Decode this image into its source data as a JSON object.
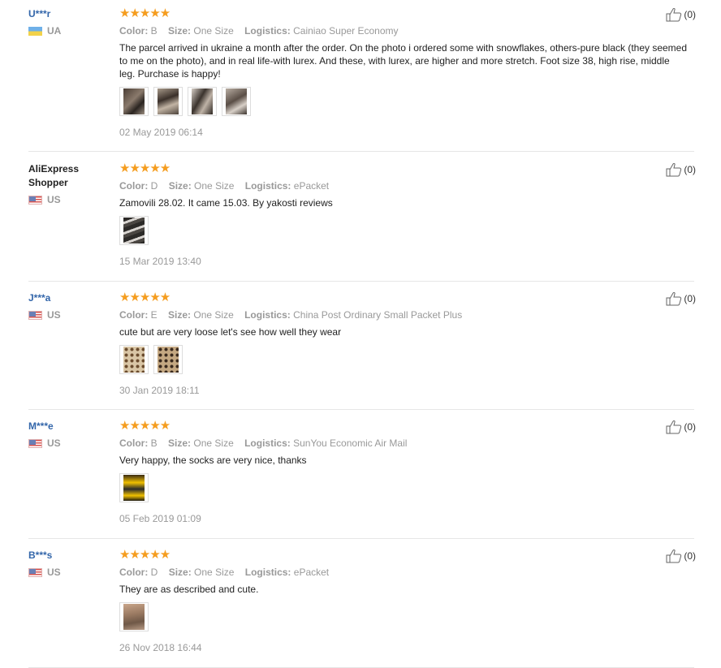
{
  "reviews": [
    {
      "user": "U***r",
      "country": "UA",
      "stars": "★★★★★",
      "color_label": "Color:",
      "color": "B",
      "size_label": "Size:",
      "size": "One Size",
      "logistics_label": "Logistics:",
      "logistics": "Cainiao Super Economy",
      "text": "The parcel arrived in ukraine a month after the order. On the photo i ordered some with snowflakes, others-pure black (they seemed to me on the photo), and in real life-with lurex. And these, with lurex, are higher and more stretch. Foot size 38, high rise, middle leg. Purchase is happy!",
      "date": "02 May 2019 06:14",
      "helpful": "(0)",
      "helpful_icon": "thumbs-up-icon",
      "photo_count": 4
    },
    {
      "user": "AliExpress Shopper",
      "country": "US",
      "stars": "★★★★★",
      "color_label": "Color:",
      "color": "D",
      "size_label": "Size:",
      "size": "One Size",
      "logistics_label": "Logistics:",
      "logistics": "ePacket",
      "text": "Zamovili 28.02. It came 15.03. By yakosti reviews",
      "date": "15 Mar 2019 13:40",
      "helpful": "(0)",
      "helpful_icon": "thumbs-up-icon",
      "photo_count": 1
    },
    {
      "user": "J***a",
      "country": "US",
      "stars": "★★★★★",
      "color_label": "Color:",
      "color": "E",
      "size_label": "Size:",
      "size": "One Size",
      "logistics_label": "Logistics:",
      "logistics": "China Post Ordinary Small Packet Plus",
      "text": "cute but are very loose let's see how well they wear",
      "date": "30 Jan 2019 18:11",
      "helpful": "(0)",
      "helpful_icon": "thumbs-up-icon",
      "photo_count": 2
    },
    {
      "user": "M***e",
      "country": "US",
      "stars": "★★★★★",
      "color_label": "Color:",
      "color": "B",
      "size_label": "Size:",
      "size": "One Size",
      "logistics_label": "Logistics:",
      "logistics": "SunYou Economic Air Mail",
      "text": "Very happy, the socks are very nice, thanks",
      "date": "05 Feb 2019 01:09",
      "helpful": "(0)",
      "helpful_icon": "thumbs-up-icon",
      "photo_count": 1
    },
    {
      "user": "B***s",
      "country": "US",
      "stars": "★★★★★",
      "color_label": "Color:",
      "color": "D",
      "size_label": "Size:",
      "size": "One Size",
      "logistics_label": "Logistics:",
      "logistics": "ePacket",
      "text": "They are as described and cute.",
      "date": "26 Nov 2018 16:44",
      "helpful": "(0)",
      "helpful_icon": "thumbs-up-icon",
      "photo_count": 1
    }
  ],
  "colors": {
    "user_link": "#3366aa",
    "star": "#f59d1f",
    "muted": "#999999",
    "divider": "#e6e6e6"
  }
}
